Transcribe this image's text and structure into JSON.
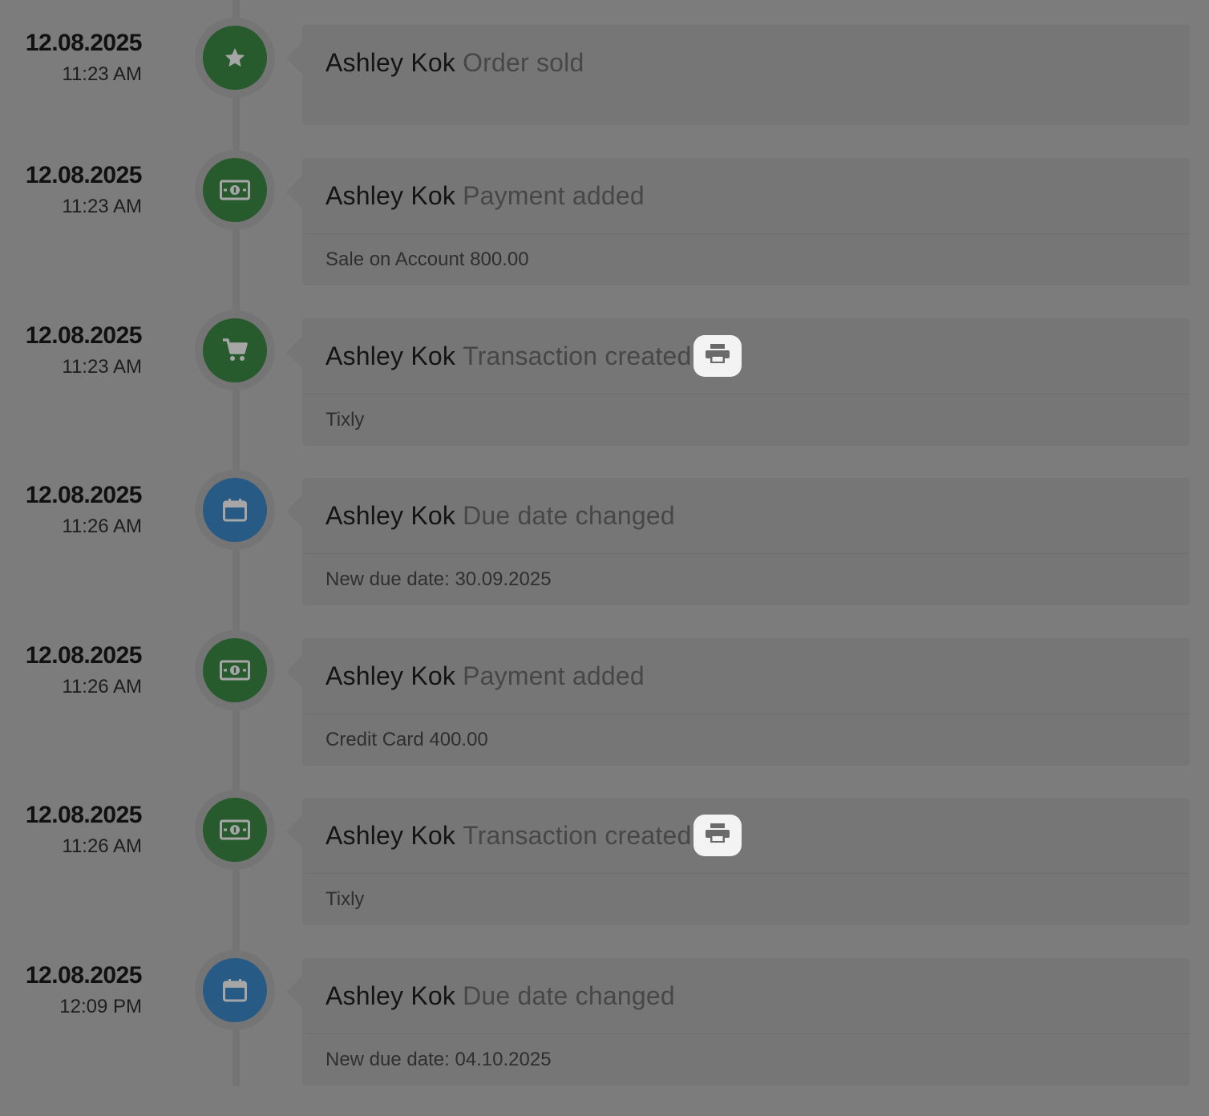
{
  "colors": {
    "overlay_background": "#7c7c7c",
    "badge_green": "#275b2e",
    "badge_blue": "#275b85",
    "print_button": "#f3f3f3"
  },
  "entries": [
    {
      "date": "12.08.2025",
      "time": "11:23 AM",
      "icon": "star-icon",
      "badge_color": "green",
      "actor": "Ashley Kok",
      "action": "Order sold",
      "detail": "",
      "has_print": false
    },
    {
      "date": "12.08.2025",
      "time": "11:23 AM",
      "icon": "money-icon",
      "badge_color": "green",
      "actor": "Ashley Kok",
      "action": "Payment added",
      "detail": "Sale on Account 800.00",
      "has_print": false
    },
    {
      "date": "12.08.2025",
      "time": "11:23 AM",
      "icon": "cart-icon",
      "badge_color": "green",
      "actor": "Ashley Kok",
      "action": "Transaction created",
      "detail": "Tixly",
      "has_print": true
    },
    {
      "date": "12.08.2025",
      "time": "11:26 AM",
      "icon": "calendar-icon",
      "badge_color": "blue",
      "actor": "Ashley Kok",
      "action": "Due date changed",
      "detail": "New due date: 30.09.2025",
      "has_print": false
    },
    {
      "date": "12.08.2025",
      "time": "11:26 AM",
      "icon": "money-icon",
      "badge_color": "green",
      "actor": "Ashley Kok",
      "action": "Payment added",
      "detail": "Credit Card 400.00",
      "has_print": false
    },
    {
      "date": "12.08.2025",
      "time": "11:26 AM",
      "icon": "money-icon",
      "badge_color": "green",
      "actor": "Ashley Kok",
      "action": "Transaction created",
      "detail": "Tixly",
      "has_print": true
    },
    {
      "date": "12.08.2025",
      "time": "12:09 PM",
      "icon": "calendar-icon",
      "badge_color": "blue",
      "actor": "Ashley Kok",
      "action": "Due date changed",
      "detail": "New due date: 04.10.2025",
      "has_print": false
    }
  ]
}
